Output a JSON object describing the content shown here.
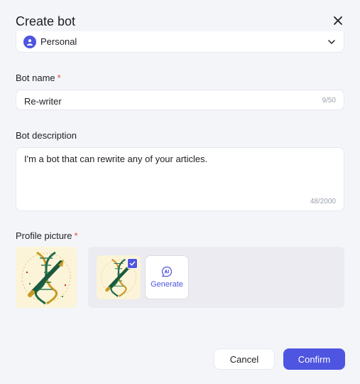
{
  "dialog": {
    "title": "Create bot",
    "close_icon": "close-icon"
  },
  "scope": {
    "value": "Personal",
    "icon": "user-icon",
    "chevron_icon": "chevron-down-icon"
  },
  "bot_name": {
    "label": "Bot name",
    "required_mark": "*",
    "value": "Re-writer",
    "counter": "9/50"
  },
  "bot_description": {
    "label": "Bot description",
    "value": "I'm a bot that can rewrite any of your articles.",
    "counter": "48/2000"
  },
  "profile_picture": {
    "label": "Profile picture",
    "required_mark": "*",
    "preview_icon": "dna-pen-image",
    "thumbnail_icon": "dna-pen-image",
    "check_icon": "checkmark-icon",
    "generate_label": "Generate",
    "generate_icon": "ai-sparkle-icon"
  },
  "footer": {
    "cancel_label": "Cancel",
    "confirm_label": "Confirm"
  },
  "colors": {
    "accent": "#4e55e0",
    "required": "#e5484d",
    "background": "#f3f5f9",
    "image_background": "#fbf4d8"
  }
}
